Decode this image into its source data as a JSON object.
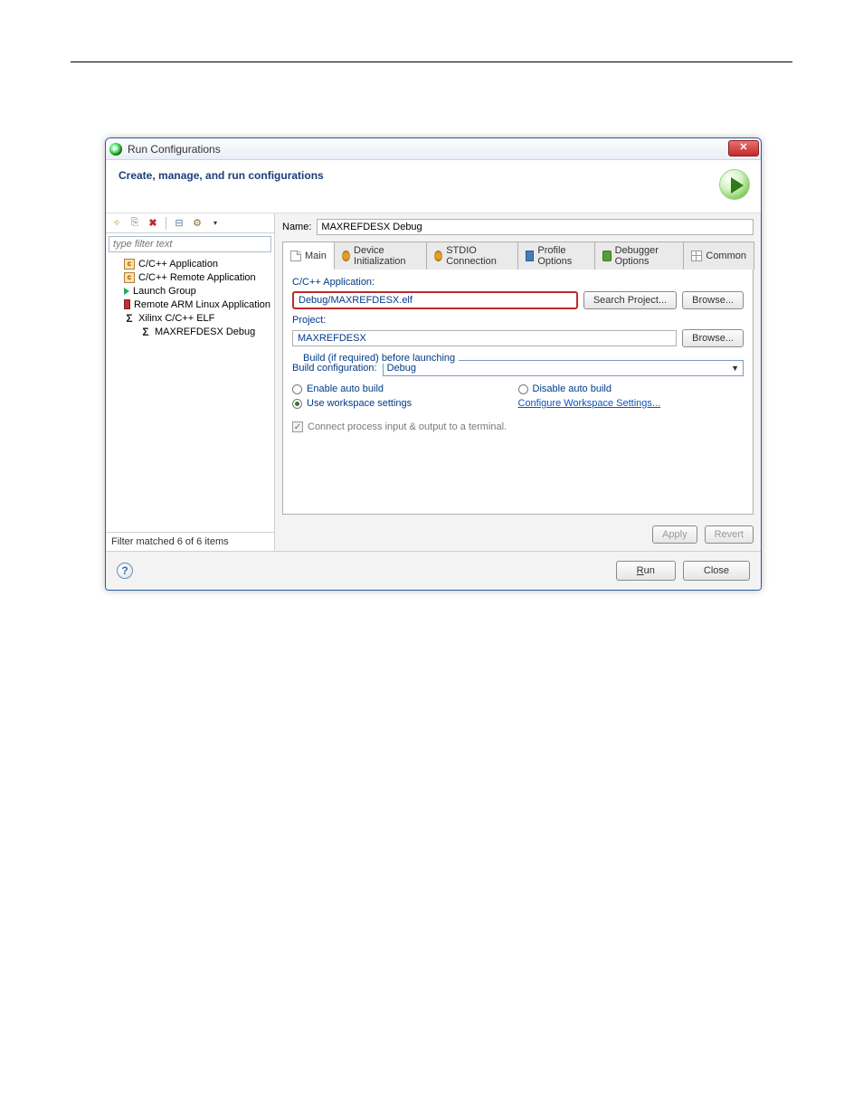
{
  "window": {
    "title": "Run Configurations",
    "close_glyph": "✕"
  },
  "header": {
    "title": "Create, manage, and run configurations"
  },
  "left": {
    "filter_placeholder": "type filter text",
    "tree": [
      {
        "label": "C/C++ Application"
      },
      {
        "label": "C/C++ Remote Application"
      },
      {
        "label": "Launch Group"
      },
      {
        "label": "Remote ARM Linux Application"
      },
      {
        "label": "Xilinx C/C++ ELF"
      },
      {
        "label": "MAXREFDESX Debug"
      }
    ],
    "filter_status": "Filter matched 6 of 6 items"
  },
  "right": {
    "name_label": "Name:",
    "name_value": "MAXREFDESX Debug",
    "tabs": {
      "main": "Main",
      "device_init": "Device Initialization",
      "stdio": "STDIO Connection",
      "profile": "Profile Options",
      "debugger": "Debugger Options",
      "common": "Common"
    },
    "main_tab": {
      "app_label": "C/C++ Application:",
      "app_value": "Debug/MAXREFDESX.elf",
      "search_project_btn": "Search Project...",
      "browse_btn": "Browse...",
      "project_label": "Project:",
      "project_value": "MAXREFDESX",
      "build_legend": "Build (if required) before launching",
      "build_config_label": "Build configuration:",
      "build_config_value": "Debug",
      "enable_auto_build": "Enable auto build",
      "disable_auto_build": "Disable auto build",
      "use_workspace": "Use workspace settings",
      "configure_link": "Configure Workspace Settings...",
      "connect_terminal": "Connect process input & output to a terminal."
    },
    "apply_btn": "Apply",
    "revert_btn": "Revert"
  },
  "footer": {
    "help_glyph": "?",
    "run_btn": "Run",
    "close_btn": "Close"
  },
  "toolbar_glyphs": {
    "new": "✧",
    "dup": "⎘",
    "del": "✖",
    "collapse": "⊟",
    "filter": "⚙",
    "drop": "▾"
  }
}
